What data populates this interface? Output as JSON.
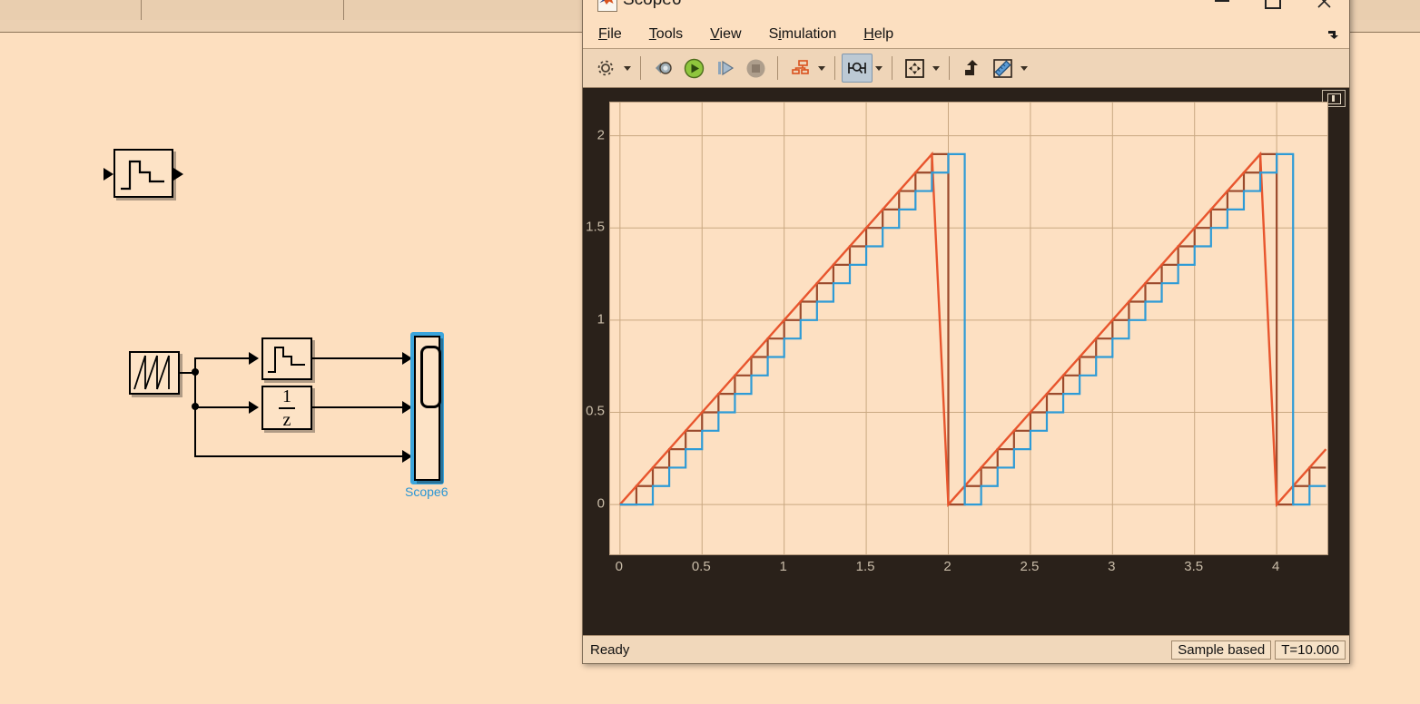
{
  "background": {
    "name": "simulink-model-canvas",
    "blocks": [
      {
        "id": "zoh-top",
        "type": "zero-order-hold-standalone",
        "label": ""
      },
      {
        "id": "sawtooth",
        "type": "sawtooth-generator",
        "label": ""
      },
      {
        "id": "zoh",
        "type": "zero-order-hold",
        "label": ""
      },
      {
        "id": "unit-delay",
        "type": "unit-delay",
        "numerator": "1",
        "denominator": "z"
      },
      {
        "id": "scope",
        "type": "scope",
        "label": "Scope6"
      }
    ],
    "scope_block_label": "Scope6",
    "selection_color": "#3BA5DC"
  },
  "window": {
    "title": "Scope6",
    "icon": "matlab-logo-icon",
    "controls": {
      "minimize": "—",
      "maximize": "□",
      "close": "✕"
    }
  },
  "menubar": {
    "items": [
      {
        "label": "File",
        "mnemonic": "F"
      },
      {
        "label": "Tools",
        "mnemonic": "T"
      },
      {
        "label": "View",
        "mnemonic": "V"
      },
      {
        "label": "Simulation",
        "mnemonic": "i"
      },
      {
        "label": "Help",
        "mnemonic": "H"
      }
    ],
    "more_icon": "overflow-arrow-icon"
  },
  "toolbar": {
    "buttons": [
      {
        "name": "configuration-properties-button",
        "icon": "gear-icon",
        "has_caret": true,
        "active": false
      },
      {
        "name": "simulink-model-button",
        "icon": "simulink-model-icon",
        "has_caret": false,
        "active": false
      },
      {
        "name": "run-button",
        "icon": "play-icon",
        "has_caret": false,
        "active": false
      },
      {
        "name": "step-forward-button",
        "icon": "step-forward-icon",
        "has_caret": false,
        "active": false
      },
      {
        "name": "stop-button",
        "icon": "stop-icon",
        "has_caret": false,
        "active": false
      },
      {
        "name": "signal-selection-button",
        "icon": "signal-hierarchy-icon",
        "has_caret": true,
        "active": false
      },
      {
        "name": "cursor-measurements-button",
        "icon": "cursor-measurement-icon",
        "has_caret": true,
        "active": true
      },
      {
        "name": "zoom-fit-button",
        "icon": "fit-to-view-icon",
        "has_caret": true,
        "active": false
      },
      {
        "name": "style-button",
        "icon": "style-icon",
        "has_caret": false,
        "active": false
      },
      {
        "name": "measurements-button",
        "icon": "ruler-icon",
        "has_caret": true,
        "active": false
      }
    ]
  },
  "plot": {
    "float_button": "float-axis-icon",
    "background_color": "#FDE0C2",
    "frame_color": "#2A211A",
    "grid_color": "#C9A882"
  },
  "statusbar": {
    "status": "Ready",
    "frame_mode": "Sample based",
    "time": "T=10.000"
  },
  "chart_data": {
    "type": "line",
    "title": "",
    "xlabel": "",
    "ylabel": "",
    "xlim": [
      -0.06,
      4.32
    ],
    "ylim": [
      -0.28,
      2.18
    ],
    "xticks": [
      0,
      0.5,
      1,
      1.5,
      2,
      2.5,
      3,
      3.5,
      4
    ],
    "xtick_labels": [
      "0",
      "0.5",
      "1",
      "1.5",
      "2",
      "2.5",
      "3",
      "3.5",
      "4"
    ],
    "yticks": [
      0,
      0.5,
      1,
      1.5,
      2
    ],
    "ytick_labels": [
      "0",
      "0.5",
      "1",
      "1.5",
      "2"
    ],
    "grid": true,
    "legend": null,
    "sample_period": 0.1,
    "sawtooth_period": 2.0,
    "sawtooth_amplitude": 1.9,
    "series": [
      {
        "name": "sawtooth-source",
        "color": "#E8552D",
        "style": "continuous-ramp",
        "description": "Continuous sawtooth ramp rising 0 to 1.9 over each 2 s period then resetting to 0",
        "points": [
          [
            0.0,
            0.0
          ],
          [
            1.9,
            1.9
          ],
          [
            2.0,
            0.0
          ],
          [
            3.9,
            1.9
          ],
          [
            4.0,
            0.0
          ],
          [
            4.3,
            0.3
          ]
        ]
      },
      {
        "name": "zero-order-hold-output",
        "color": "#9B4A2C",
        "style": "staircase",
        "description": "Sampled-and-held sawtooth, step height 0.1 every 0.1 s",
        "values": [
          0.0,
          0.1,
          0.2,
          0.3,
          0.4,
          0.5,
          0.6,
          0.7,
          0.8,
          0.9,
          1.0,
          1.1,
          1.2,
          1.3,
          1.4,
          1.5,
          1.6,
          1.7,
          1.8,
          1.9,
          0.0,
          0.1,
          0.2,
          0.3,
          0.4,
          0.5,
          0.6,
          0.7,
          0.8,
          0.9,
          1.0,
          1.1,
          1.2,
          1.3,
          1.4,
          1.5,
          1.6,
          1.7,
          1.8,
          1.9,
          0.0,
          0.1,
          0.2
        ],
        "x_start": 0.0,
        "x_step": 0.1
      },
      {
        "name": "unit-delay-output",
        "color": "#2E9BD6",
        "style": "staircase",
        "description": "Unit delay (1/z) of sampled sawtooth, lagging the hold output by one sample",
        "values": [
          0.0,
          0.0,
          0.1,
          0.2,
          0.3,
          0.4,
          0.5,
          0.6,
          0.7,
          0.8,
          0.9,
          1.0,
          1.1,
          1.2,
          1.3,
          1.4,
          1.5,
          1.6,
          1.7,
          1.8,
          1.9,
          0.0,
          0.1,
          0.2,
          0.3,
          0.4,
          0.5,
          0.6,
          0.7,
          0.8,
          0.9,
          1.0,
          1.1,
          1.2,
          1.3,
          1.4,
          1.5,
          1.6,
          1.7,
          1.8,
          1.9,
          0.0,
          0.1
        ],
        "x_start": 0.0,
        "x_step": 0.1
      }
    ]
  }
}
